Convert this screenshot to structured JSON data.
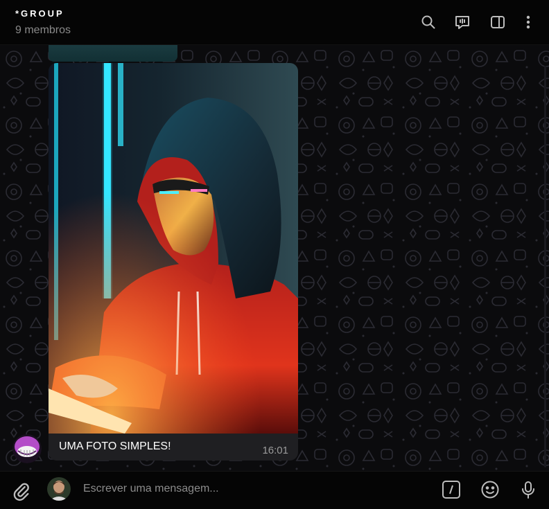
{
  "header": {
    "title": "*GROUP",
    "members": "9 membros",
    "icons": [
      "search-icon",
      "video-chat-icon",
      "sidebar-toggle-icon",
      "more-vertical-icon"
    ]
  },
  "message": {
    "caption": "UMA FOTO SIMPLES!",
    "time": "16:01",
    "image": "photo of a hooded person typing on a glowing keyboard"
  },
  "composer": {
    "placeholder": "Escrever uma mensagem...",
    "icons": [
      "attach-icon",
      "commands-icon",
      "emoji-icon",
      "microphone-icon"
    ]
  },
  "colors": {
    "background": "#000000",
    "header": "#050505",
    "bubble": "#1f1f22",
    "muted_text": "#8a8a8a",
    "icon": "#bdbdbd"
  }
}
